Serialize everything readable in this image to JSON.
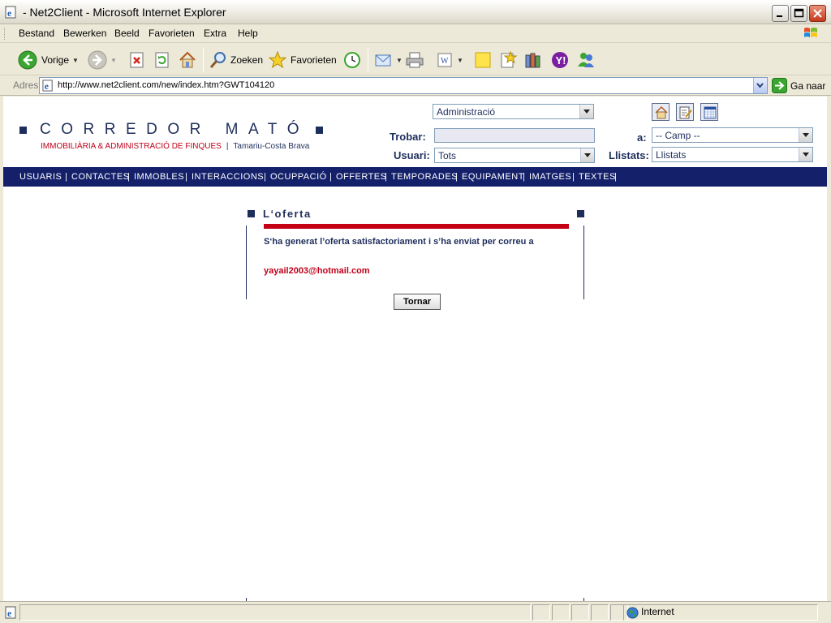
{
  "window": {
    "title": "- Net2Client - Microsoft Internet Explorer"
  },
  "menu": {
    "items": [
      "Bestand",
      "Bewerken",
      "Beeld",
      "Favorieten",
      "Extra",
      "Help"
    ]
  },
  "toolbar": {
    "back_label": "Vorige",
    "search_label": "Zoeken",
    "favorites_label": "Favorieten"
  },
  "address": {
    "label": "Adres",
    "url": "http://www.net2client.com/new/index.htm?GWT104120",
    "go_label": "Ga naar"
  },
  "header": {
    "logo_text": "CORREDOR MATÓ",
    "tagline_red": "IMMOBILIÀRIA & ADMINISTRACIÓ DE FINQUES",
    "tagline_sep": "|",
    "tagline_blue": "Tamariu-Costa Brava",
    "section_select": "Administració",
    "trobar_label": "Trobar:",
    "usuari_label": "Usuari:",
    "usuari_value": "Tots",
    "a_label": "a:",
    "camp_value": "-- Camp --",
    "llistats_label": "Llistats:",
    "llistats_value": "Llistats"
  },
  "nav": {
    "items": [
      "USUARIS",
      "CONTACTES",
      "IMMOBLES",
      "INTERACCIONS",
      "OCUPPACIÓ",
      "OFFERTES",
      "TEMPORADES",
      "EQUIPAMENT",
      "IMATGES",
      "TEXTES"
    ],
    "separator": "|"
  },
  "panel": {
    "title": "L‘oferta",
    "message": "S‘ha generat l’oferta satisfactoriament i s’ha enviat per correu a",
    "email": "yayail2003@hotmail.com",
    "button": "Tornar"
  },
  "status": {
    "zone": "Internet"
  },
  "colors": {
    "brand_navy": "#1E2E5C",
    "nav_bg": "#14216A",
    "brand_red": "#C0001A"
  }
}
